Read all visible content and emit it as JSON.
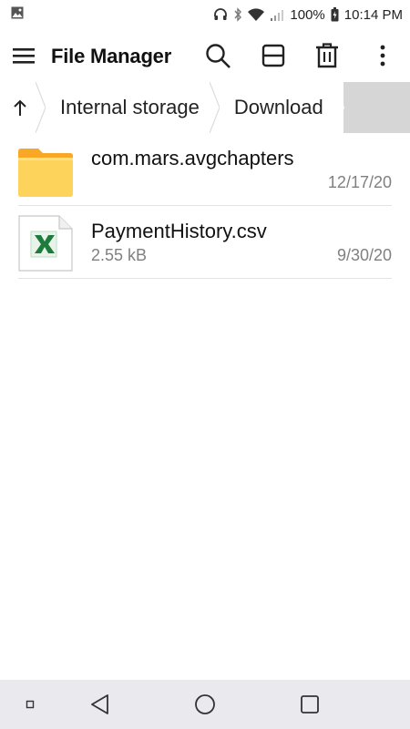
{
  "status_bar": {
    "battery_text": "100%",
    "time": "10:14 PM",
    "icons": [
      "image-notification-icon",
      "headset-icon",
      "bluetooth-icon",
      "wifi-icon",
      "signal-icon",
      "battery-icon"
    ]
  },
  "app_bar": {
    "title": "File Manager",
    "icons": [
      "menu-icon",
      "search-icon",
      "view-toggle-icon",
      "trash-icon",
      "more-vert-icon"
    ]
  },
  "breadcrumb": {
    "up_icon": "up-arrow-icon",
    "crumbs": [
      "Internal storage",
      "Download"
    ]
  },
  "files": [
    {
      "name": "com.mars.avgchapters",
      "size": "",
      "date": "12/17/20",
      "type": "folder",
      "icon": "folder-icon",
      "color": "#FBC02D"
    },
    {
      "name": "PaymentHistory.csv",
      "size": "2.55 kB",
      "date": "9/30/20",
      "type": "csv",
      "icon": "excel-csv-icon",
      "color": "#1E7B3C"
    }
  ],
  "nav_bar": {
    "icons": [
      "recent-square-small-icon",
      "back-icon",
      "home-icon",
      "overview-icon"
    ]
  }
}
